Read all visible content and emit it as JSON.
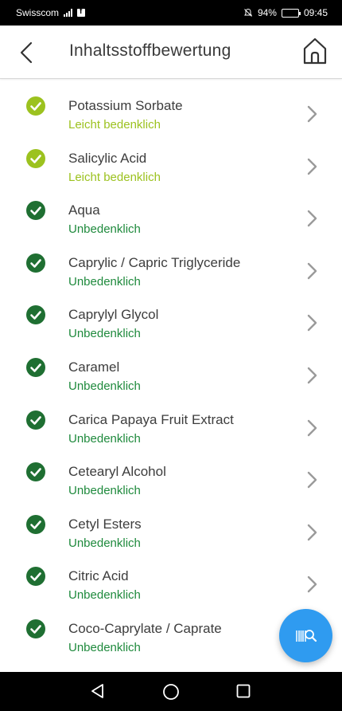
{
  "status_bar": {
    "carrier": "Swisscom",
    "battery": "94%",
    "time": "09:45",
    "battery_level": 0.94
  },
  "header": {
    "title": "Inhaltsstoffbewertung",
    "back_icon": "chevron-left-icon",
    "home_icon": "home-icon"
  },
  "colors": {
    "light_concern": "#9cc21f",
    "harmless": "#1f8a3d",
    "check_light": "#9cc21f",
    "check_dark": "#1f6f32",
    "fab": "#2f9bf0"
  },
  "ingredients": [
    {
      "name": "Potassium Sorbate",
      "rating": "Leicht bedenklich",
      "level": "light"
    },
    {
      "name": "Salicylic Acid",
      "rating": "Leicht bedenklich",
      "level": "light"
    },
    {
      "name": "Aqua",
      "rating": "Unbedenklich",
      "level": "ok"
    },
    {
      "name": "Caprylic / Capric Triglyceride",
      "rating": "Unbedenklich",
      "level": "ok"
    },
    {
      "name": "Caprylyl Glycol",
      "rating": "Unbedenklich",
      "level": "ok"
    },
    {
      "name": "Caramel",
      "rating": "Unbedenklich",
      "level": "ok"
    },
    {
      "name": "Carica Papaya Fruit Extract",
      "rating": "Unbedenklich",
      "level": "ok"
    },
    {
      "name": "Cetearyl Alcohol",
      "rating": "Unbedenklich",
      "level": "ok"
    },
    {
      "name": "Cetyl Esters",
      "rating": "Unbedenklich",
      "level": "ok"
    },
    {
      "name": "Citric Acid",
      "rating": "Unbedenklich",
      "level": "ok"
    },
    {
      "name": "Coco-Caprylate / Caprate",
      "rating": "Unbedenklich",
      "level": "ok"
    }
  ],
  "fab": {
    "icon": "barcode-search-icon"
  },
  "navbar": {
    "back_icon": "nav-back-triangle-icon",
    "home_icon": "nav-home-circle-icon",
    "recent_icon": "nav-recent-square-icon"
  }
}
